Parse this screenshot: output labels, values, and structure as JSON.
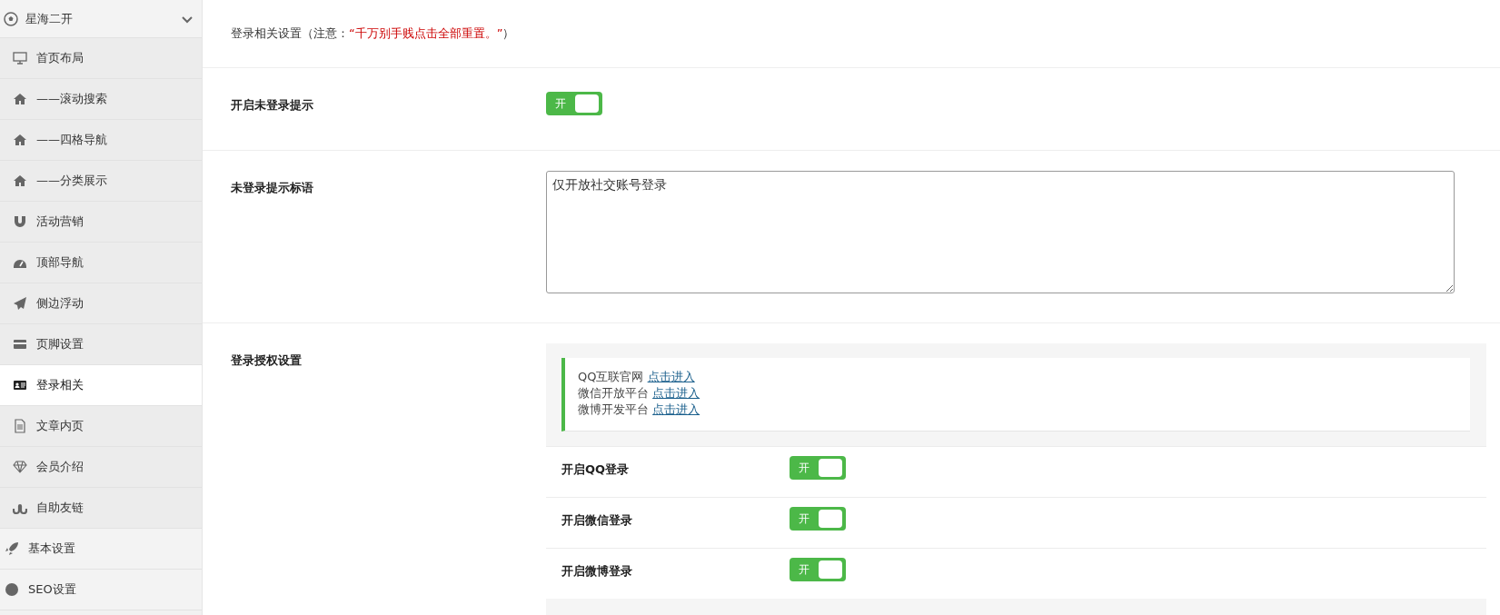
{
  "sidebar": {
    "group": {
      "title": "星海二开",
      "expanded": true,
      "items": [
        {
          "label": "首页布局",
          "selected": false
        },
        {
          "label": "——滚动搜索",
          "selected": false
        },
        {
          "label": "——四格导航",
          "selected": false
        },
        {
          "label": "——分类展示",
          "selected": false
        },
        {
          "label": "活动营销",
          "selected": false
        },
        {
          "label": "顶部导航",
          "selected": false
        },
        {
          "label": "侧边浮动",
          "selected": false
        },
        {
          "label": "页脚设置",
          "selected": false
        },
        {
          "label": "登录相关",
          "selected": true
        },
        {
          "label": "文章内页",
          "selected": false
        },
        {
          "label": "会员介绍",
          "selected": false
        },
        {
          "label": "自助友链",
          "selected": false
        }
      ]
    },
    "other_items": [
      {
        "label": "基本设置"
      },
      {
        "label": "SEO设置"
      }
    ]
  },
  "header": {
    "title": "登录相关设置（注意：",
    "warning": "“千万别手贱点击全部重置。”",
    "close": "）"
  },
  "settings": [
    {
      "kind": "toggle",
      "label": "开启未登录提示",
      "toggle_label": "开",
      "on": true
    },
    {
      "kind": "textarea",
      "label": "未登录提示标语",
      "value": "仅开放社交账号登录"
    },
    {
      "kind": "group",
      "label": "登录授权设置",
      "notice": [
        {
          "text": "QQ互联官网",
          "link": "点击进入"
        },
        {
          "text": "微信开放平台",
          "link": "点击进入"
        },
        {
          "text": "微博开发平台",
          "link": "点击进入"
        }
      ],
      "rows": [
        {
          "label": "开启QQ登录",
          "toggle_label": "开",
          "on": true
        },
        {
          "label": "开启微信登录",
          "toggle_label": "开",
          "on": true
        },
        {
          "label": "开启微博登录",
          "toggle_label": "开",
          "on": true
        }
      ]
    }
  ]
}
